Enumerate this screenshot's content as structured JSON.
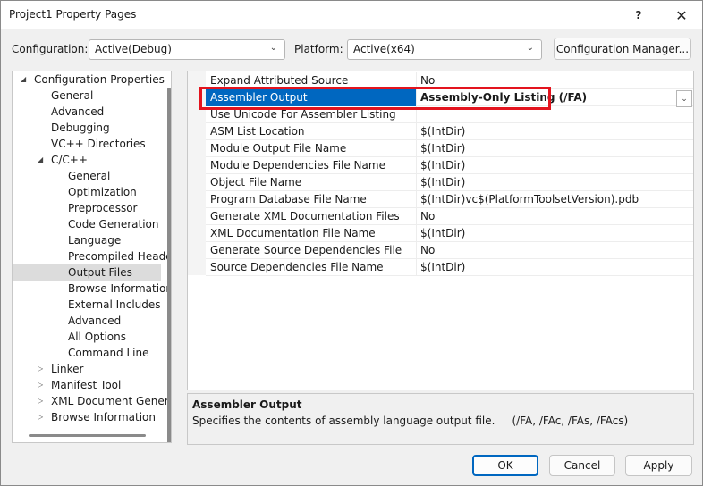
{
  "window": {
    "title": "Project1 Property Pages",
    "help_label": "?",
    "close_label": "✕"
  },
  "config_bar": {
    "configuration_label": "Configuration:",
    "configuration_value": "Active(Debug)",
    "platform_label": "Platform:",
    "platform_value": "Active(x64)",
    "config_manager_label": "Configuration Manager..."
  },
  "tree": {
    "items": [
      {
        "label": "Configuration Properties",
        "level": 0,
        "expander": "expanded"
      },
      {
        "label": "General",
        "level": 1
      },
      {
        "label": "Advanced",
        "level": 1
      },
      {
        "label": "Debugging",
        "level": 1
      },
      {
        "label": "VC++ Directories",
        "level": 1
      },
      {
        "label": "C/C++",
        "level": 1,
        "expander": "expanded"
      },
      {
        "label": "General",
        "level": 2
      },
      {
        "label": "Optimization",
        "level": 2
      },
      {
        "label": "Preprocessor",
        "level": 2
      },
      {
        "label": "Code Generation",
        "level": 2
      },
      {
        "label": "Language",
        "level": 2
      },
      {
        "label": "Precompiled Heade",
        "level": 2
      },
      {
        "label": "Output Files",
        "level": 2,
        "selected": true
      },
      {
        "label": "Browse Information",
        "level": 2
      },
      {
        "label": "External Includes",
        "level": 2
      },
      {
        "label": "Advanced",
        "level": 2
      },
      {
        "label": "All Options",
        "level": 2
      },
      {
        "label": "Command Line",
        "level": 2
      },
      {
        "label": "Linker",
        "level": 1,
        "expander": "collapsed"
      },
      {
        "label": "Manifest Tool",
        "level": 1,
        "expander": "collapsed"
      },
      {
        "label": "XML Document Genera",
        "level": 1,
        "expander": "collapsed"
      },
      {
        "label": "Browse Information",
        "level": 1,
        "expander": "collapsed"
      }
    ]
  },
  "grid": {
    "rows": [
      {
        "name": "Expand Attributed Source",
        "value": "No"
      },
      {
        "name": "Assembler Output",
        "value": "Assembly-Only Listing (/FA)",
        "selected": true
      },
      {
        "name": "Use Unicode For Assembler Listing",
        "value": ""
      },
      {
        "name": "ASM List Location",
        "value": "$(IntDir)"
      },
      {
        "name": "Module Output File Name",
        "value": "$(IntDir)"
      },
      {
        "name": "Module Dependencies File Name",
        "value": "$(IntDir)"
      },
      {
        "name": "Object File Name",
        "value": "$(IntDir)"
      },
      {
        "name": "Program Database File Name",
        "value": "$(IntDir)vc$(PlatformToolsetVersion).pdb"
      },
      {
        "name": "Generate XML Documentation Files",
        "value": "No"
      },
      {
        "name": "XML Documentation File Name",
        "value": "$(IntDir)"
      },
      {
        "name": "Generate Source Dependencies File",
        "value": "No"
      },
      {
        "name": "Source Dependencies File Name",
        "value": "$(IntDir)"
      }
    ]
  },
  "description": {
    "title": "Assembler Output",
    "text": "Specifies the contents of assembly language output file.     (/FA, /FAc, /FAs, /FAcs)"
  },
  "buttons": {
    "ok": "OK",
    "cancel": "Cancel",
    "apply": "Apply"
  },
  "colors": {
    "selection_blue": "#0067c0",
    "highlight_red": "#e3141e"
  }
}
